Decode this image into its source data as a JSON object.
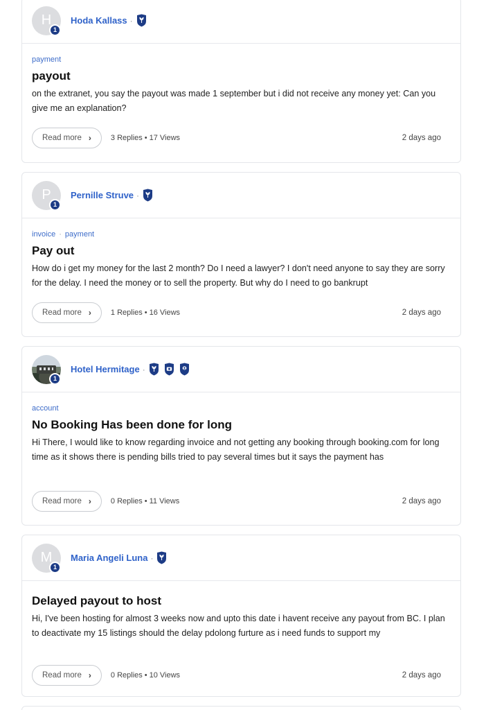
{
  "posts": [
    {
      "author": "Hoda Kallass",
      "avatar_initial": "H",
      "level": "1",
      "badges": [
        "shield-plant-icon"
      ],
      "tags": [
        "payment"
      ],
      "title": "payout",
      "excerpt": "on the extranet, you say the payout was made 1 september but i did not receive any money yet: Can you give me an explanation?",
      "read_more": "Read more",
      "replies": "3 Replies",
      "views": "17 Views",
      "age": "2 days ago"
    },
    {
      "author": "Pernille Struve",
      "avatar_initial": "P",
      "level": "1",
      "badges": [
        "shield-plant-icon"
      ],
      "tags": [
        "invoice",
        "payment"
      ],
      "title": "Pay out",
      "excerpt": "How do i get my money for the last 2 month? Do I need a lawyer? I don't need anyone to say they are sorry for the delay. I need the money or to sell the property. But why do I need to go bankrupt",
      "read_more": "Read more",
      "replies": "1 Replies",
      "views": "16 Views",
      "age": "2 days ago"
    },
    {
      "author": "Hotel Hermitage",
      "avatar_initial": "",
      "level": "1",
      "badges": [
        "shield-plant-icon",
        "shield-camera-icon",
        "shield-person-icon"
      ],
      "tags": [
        "account"
      ],
      "title": "No Booking Has been done for long",
      "excerpt": "Hi There, I would like to know regarding invoice and not getting any booking through booking.com for long time as it shows there is pending bills tried to pay several times but it says the payment has",
      "read_more": "Read more",
      "replies": "0 Replies",
      "views": "11 Views",
      "age": "2 days ago"
    },
    {
      "author": "Maria Angeli Luna",
      "avatar_initial": "M",
      "level": "1",
      "badges": [
        "shield-plant-icon"
      ],
      "tags": [],
      "title": "Delayed payout to host",
      "excerpt": "Hi, I've been hosting for almost 3 weeks now and upto this date i havent receive any payout from BC. I plan to deactivate my 15 listings should the delay pdolong furture as i need funds to support my",
      "read_more": "Read more",
      "replies": "0 Replies",
      "views": "10 Views",
      "age": "2 days ago"
    }
  ],
  "colors": {
    "author_link": "#2f62c9",
    "tag_link": "#3d6cc9",
    "badge_navy": "#1d3c86"
  }
}
